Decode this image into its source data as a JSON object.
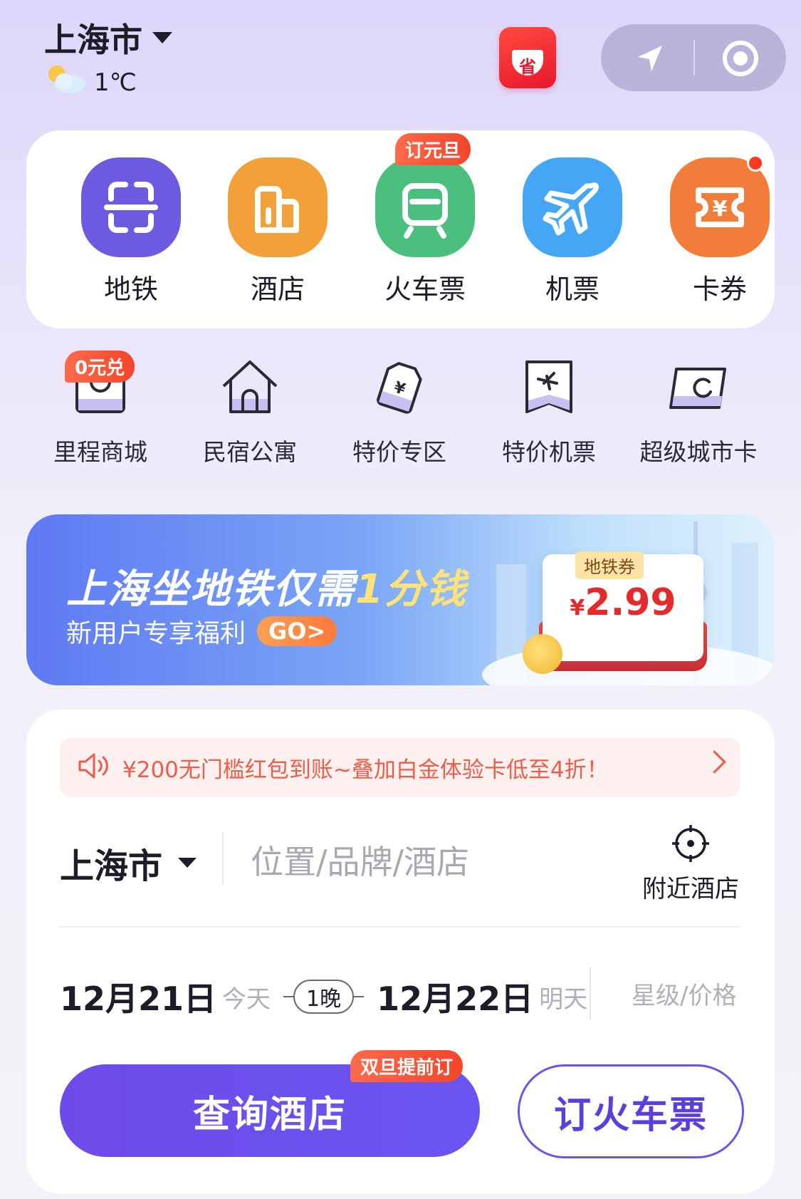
{
  "header": {
    "city": "上海市",
    "temperature": "1℃",
    "weather_icon": "partly-cloudy-icon",
    "save_badge": "省"
  },
  "main_services": [
    {
      "label": "地铁",
      "icon": "scan-icon",
      "color": "#6c5be0"
    },
    {
      "label": "酒店",
      "icon": "building-icon",
      "color": "#f2a03a"
    },
    {
      "label": "火车票",
      "icon": "train-icon",
      "color": "#4bc07e",
      "tag": "订元旦"
    },
    {
      "label": "机票",
      "icon": "plane-icon",
      "color": "#44a6f5"
    },
    {
      "label": "卡券",
      "icon": "ticket-icon",
      "color": "#f27c3a",
      "dot": true
    }
  ],
  "secondary_services": [
    {
      "label": "里程商城",
      "icon": "shopping-bag-icon",
      "tag": "0元兑"
    },
    {
      "label": "民宿公寓",
      "icon": "house-icon"
    },
    {
      "label": "特价专区",
      "icon": "price-tag-icon"
    },
    {
      "label": "特价机票",
      "icon": "plane-ticket-icon"
    },
    {
      "label": "超级城市卡",
      "icon": "city-card-icon"
    }
  ],
  "banner": {
    "title_main": "上海坐地铁仅需",
    "title_highlight": "1分钱",
    "subtitle": "新用户专享福利",
    "go_label": "GO>",
    "coupon_title": "地铁券",
    "coupon_currency": "¥",
    "coupon_price": "2.99"
  },
  "booking": {
    "notice": "¥200无门槛红包到账~叠加白金体验卡低至4折！",
    "city": "上海市",
    "search_placeholder": "位置/品牌/酒店",
    "nearby_label": "附近酒店",
    "checkin_date": "12月21日",
    "checkin_day": "今天",
    "nights": "1晚",
    "checkout_date": "12月22日",
    "checkout_day": "明天",
    "star_price": "星级/价格",
    "search_button": "查询酒店",
    "search_button_tag": "双旦提前订",
    "train_button": "订火车票"
  },
  "colors": {
    "primary": "#6a55f0",
    "accent_orange": "#f2452a",
    "notice_text": "#ea5e4b"
  }
}
